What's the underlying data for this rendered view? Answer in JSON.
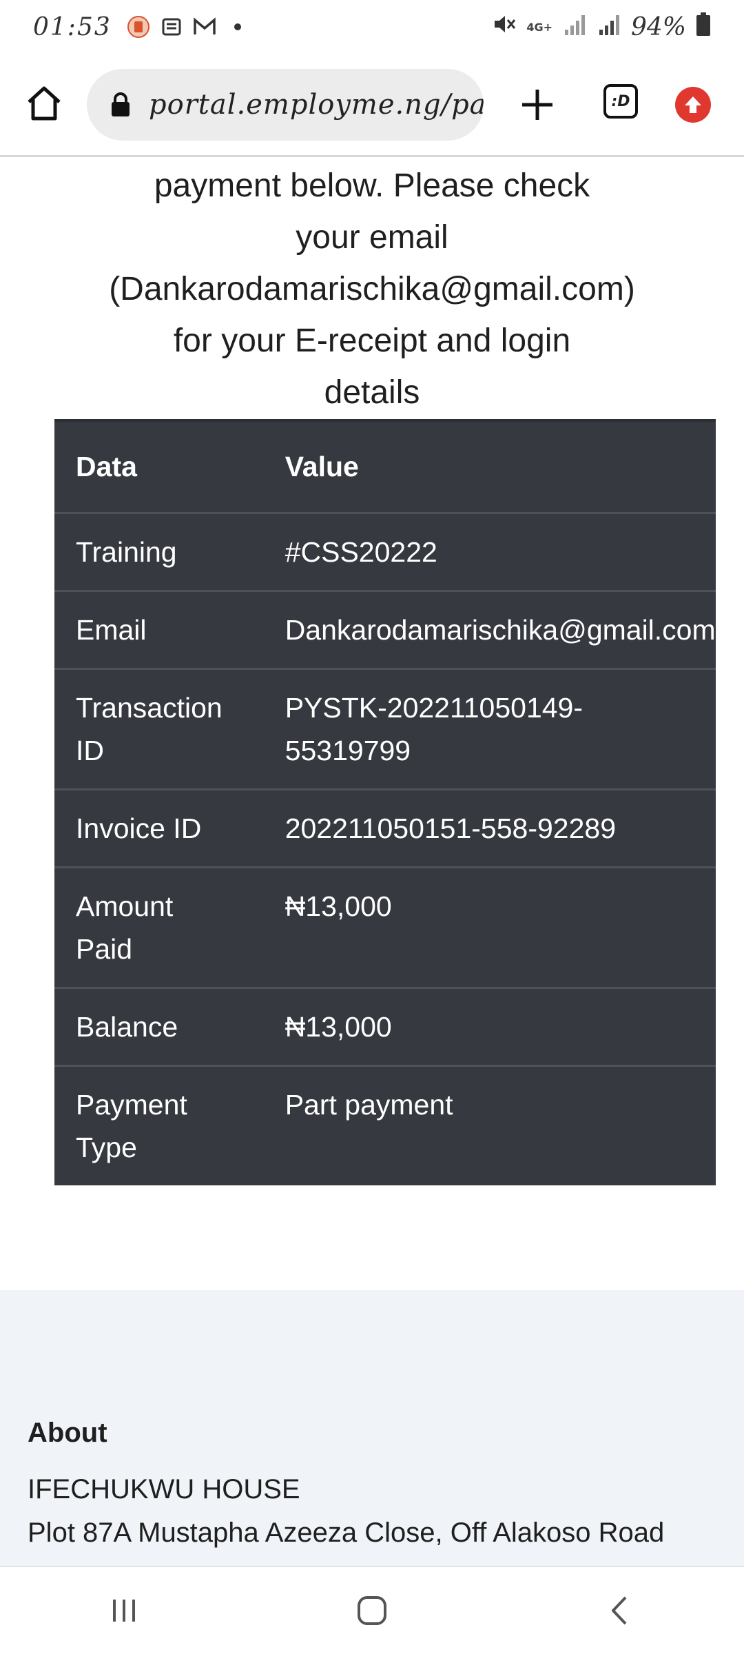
{
  "status_bar": {
    "time": "01:53",
    "battery": "94%",
    "network": "4G+",
    "notification_icons": [
      "app-icon",
      "message-icon",
      "gmail-icon",
      "dot-icon"
    ],
    "right_icons": [
      "mute-icon",
      "signal-icon",
      "signal-icon",
      "battery-icon"
    ]
  },
  "browser": {
    "url": "portal.employme.ng/pay",
    "tabs_label": ":D",
    "icons": [
      "home-icon",
      "lock-icon",
      "plus-icon",
      "tabs-icon",
      "upgrade-icon"
    ]
  },
  "intro": {
    "lines": [
      "payment below. Please check",
      "your email",
      "(Dankarodamarischika@gmail.com)",
      "for your E-receipt and login",
      "details"
    ]
  },
  "table": {
    "headers": [
      "Data",
      "Value"
    ],
    "rows": [
      {
        "key": "Training",
        "value": "#CSS20222"
      },
      {
        "key": "Email",
        "value": "Dankarodamarischika@gmail.com"
      },
      {
        "key": "Transaction ID",
        "value": "PYSTK-202211050149-55319799"
      },
      {
        "key": "Invoice ID",
        "value": "202211050151-558-92289"
      },
      {
        "key": "Amount Paid",
        "value": "₦13,000"
      },
      {
        "key": "Balance",
        "value": "₦13,000"
      },
      {
        "key": "Payment Type",
        "value": "Part payment"
      }
    ]
  },
  "footer": {
    "about_title": "About",
    "address_line1": "IFECHUKWU HOUSE",
    "address_line2": "Plot 87A Mustapha Azeeza Close, Off Alakoso Road"
  },
  "colors": {
    "table_bg": "#363a40",
    "footer_bg": "#f0f3f8",
    "upgrade_red": "#e0382e"
  }
}
